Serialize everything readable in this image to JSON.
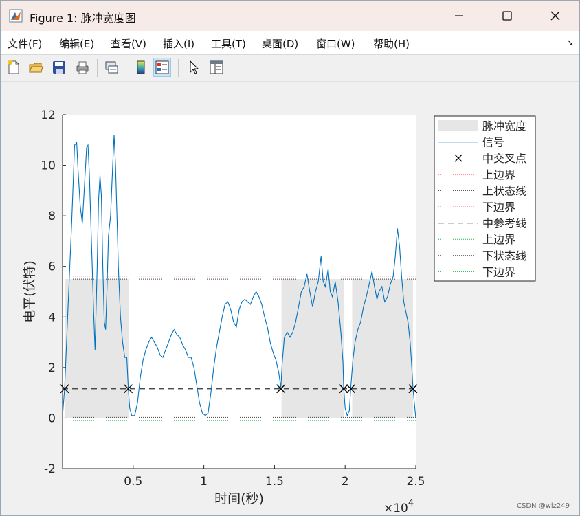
{
  "window": {
    "title": "Figure 1: 脉冲宽度图",
    "icon": "matlab-logo-icon",
    "controls": [
      "minimize-icon",
      "maximize-icon",
      "close-icon"
    ]
  },
  "menu": [
    "文件(F)",
    "编辑(E)",
    "查看(V)",
    "插入(I)",
    "工具(T)",
    "桌面(D)",
    "窗口(W)",
    "帮助(H)"
  ],
  "menu_extra_icon": "dock-arrow-icon",
  "toolbar": [
    "new-figure-icon",
    "open-file-icon",
    "save-icon",
    "print-icon",
    "link-plot-icon",
    "colorbar-icon",
    "legend-icon",
    "pointer-icon",
    "property-inspector-icon"
  ],
  "watermark": "CSDN @wlz249",
  "chart_data": {
    "type": "line",
    "xlabel": "时间(秒)",
    "ylabel": "电平(伏特)",
    "x_exponent": "×10",
    "x_exponent_power": "4",
    "xlim": [
      0,
      25000
    ],
    "ylim": [
      -2,
      12
    ],
    "xticks": [
      0.5,
      1,
      1.5,
      2,
      2.5
    ],
    "xtick_labels": [
      "0.5",
      "1",
      "1.5",
      "2",
      "2.5"
    ],
    "yticks": [
      -2,
      0,
      2,
      4,
      6,
      8,
      10,
      12
    ],
    "ytick_labels": [
      "-2",
      "0",
      "2",
      "4",
      "6",
      "8",
      "10",
      "12"
    ],
    "grid": false,
    "legend_position": "outside-right",
    "colors": {
      "signal": "#0072bd",
      "pulse_fill": "#e6e6e6",
      "boundary": "#ff6b6b",
      "state": "#444444",
      "lower_boundary": "#22b14c",
      "reference": "#333333"
    },
    "pulse_width_regions": [
      [
        200,
        4700
      ],
      [
        15500,
        19900
      ],
      [
        20500,
        24800
      ]
    ],
    "pulse_region_top": 5.5,
    "levels": {
      "upper_boundary": 5.62,
      "upper_state": 5.5,
      "lower_boundary_red": 5.38,
      "mid_reference": 1.16,
      "upper_boundary_green": 0.16,
      "lower_state": 0.03,
      "lower_boundary_green": -0.1
    },
    "mid_crossings": [
      150,
      4650,
      15450,
      19900,
      20400,
      24800
    ],
    "series": [
      {
        "name": "信号",
        "points": [
          [
            0,
            0.1
          ],
          [
            150,
            1.2
          ],
          [
            400,
            4.5
          ],
          [
            650,
            7.8
          ],
          [
            850,
            10.8
          ],
          [
            1000,
            10.9
          ],
          [
            1100,
            9.8
          ],
          [
            1250,
            8.4
          ],
          [
            1400,
            7.7
          ],
          [
            1550,
            9.2
          ],
          [
            1700,
            10.7
          ],
          [
            1800,
            10.8
          ],
          [
            1900,
            9.6
          ],
          [
            2000,
            7.8
          ],
          [
            2100,
            6.0
          ],
          [
            2200,
            4.2
          ],
          [
            2300,
            2.7
          ],
          [
            2450,
            6.0
          ],
          [
            2550,
            8.6
          ],
          [
            2650,
            9.6
          ],
          [
            2750,
            8.8
          ],
          [
            2850,
            6.0
          ],
          [
            2950,
            3.8
          ],
          [
            3050,
            3.5
          ],
          [
            3150,
            5.2
          ],
          [
            3250,
            7.2
          ],
          [
            3400,
            8.0
          ],
          [
            3550,
            10.0
          ],
          [
            3650,
            11.2
          ],
          [
            3750,
            10.0
          ],
          [
            3850,
            8.0
          ],
          [
            3950,
            6.0
          ],
          [
            4100,
            4.0
          ],
          [
            4250,
            3.0
          ],
          [
            4400,
            2.4
          ],
          [
            4550,
            2.4
          ],
          [
            4650,
            1.2
          ],
          [
            4750,
            0.4
          ],
          [
            4900,
            0.1
          ],
          [
            5100,
            0.1
          ],
          [
            5300,
            0.6
          ],
          [
            5500,
            1.6
          ],
          [
            5700,
            2.3
          ],
          [
            5900,
            2.7
          ],
          [
            6100,
            3.0
          ],
          [
            6300,
            3.2
          ],
          [
            6500,
            3.0
          ],
          [
            6700,
            2.8
          ],
          [
            6900,
            2.5
          ],
          [
            7100,
            2.4
          ],
          [
            7300,
            2.7
          ],
          [
            7500,
            3.0
          ],
          [
            7700,
            3.3
          ],
          [
            7900,
            3.5
          ],
          [
            8100,
            3.3
          ],
          [
            8300,
            3.2
          ],
          [
            8500,
            2.9
          ],
          [
            8700,
            2.7
          ],
          [
            8900,
            2.4
          ],
          [
            9100,
            2.4
          ],
          [
            9300,
            2.0
          ],
          [
            9500,
            1.3
          ],
          [
            9700,
            0.6
          ],
          [
            9900,
            0.2
          ],
          [
            10100,
            0.1
          ],
          [
            10300,
            0.2
          ],
          [
            10500,
            1.0
          ],
          [
            10700,
            2.0
          ],
          [
            10900,
            2.8
          ],
          [
            11100,
            3.4
          ],
          [
            11300,
            4.0
          ],
          [
            11500,
            4.5
          ],
          [
            11700,
            4.6
          ],
          [
            11900,
            4.3
          ],
          [
            12100,
            3.8
          ],
          [
            12300,
            3.6
          ],
          [
            12500,
            4.3
          ],
          [
            12700,
            4.6
          ],
          [
            12900,
            4.7
          ],
          [
            13100,
            4.6
          ],
          [
            13300,
            4.5
          ],
          [
            13500,
            4.8
          ],
          [
            13700,
            5.0
          ],
          [
            13900,
            4.8
          ],
          [
            14100,
            4.5
          ],
          [
            14300,
            4.0
          ],
          [
            14500,
            3.6
          ],
          [
            14700,
            3.0
          ],
          [
            14900,
            2.6
          ],
          [
            15100,
            2.3
          ],
          [
            15300,
            1.8
          ],
          [
            15450,
            1.2
          ],
          [
            15550,
            2.2
          ],
          [
            15700,
            3.2
          ],
          [
            15900,
            3.4
          ],
          [
            16100,
            3.2
          ],
          [
            16300,
            3.4
          ],
          [
            16500,
            3.8
          ],
          [
            16700,
            4.4
          ],
          [
            16900,
            5.0
          ],
          [
            17100,
            5.2
          ],
          [
            17300,
            5.7
          ],
          [
            17500,
            5.0
          ],
          [
            17700,
            4.4
          ],
          [
            17900,
            5.0
          ],
          [
            18100,
            5.4
          ],
          [
            18300,
            6.4
          ],
          [
            18450,
            5.4
          ],
          [
            18600,
            5.2
          ],
          [
            18800,
            5.9
          ],
          [
            18950,
            5.0
          ],
          [
            19100,
            4.8
          ],
          [
            19300,
            5.4
          ],
          [
            19500,
            4.6
          ],
          [
            19700,
            3.4
          ],
          [
            19850,
            2.2
          ],
          [
            19900,
            1.2
          ],
          [
            20000,
            0.4
          ],
          [
            20150,
            0.1
          ],
          [
            20300,
            0.3
          ],
          [
            20400,
            1.2
          ],
          [
            20550,
            2.3
          ],
          [
            20700,
            3.0
          ],
          [
            20900,
            3.5
          ],
          [
            21100,
            3.8
          ],
          [
            21300,
            4.4
          ],
          [
            21500,
            4.8
          ],
          [
            21700,
            5.3
          ],
          [
            21900,
            5.8
          ],
          [
            22050,
            5.3
          ],
          [
            22250,
            4.7
          ],
          [
            22400,
            5.0
          ],
          [
            22600,
            5.2
          ],
          [
            22800,
            4.6
          ],
          [
            23000,
            4.8
          ],
          [
            23200,
            5.3
          ],
          [
            23400,
            5.6
          ],
          [
            23550,
            6.4
          ],
          [
            23700,
            7.5
          ],
          [
            23850,
            6.8
          ],
          [
            24000,
            5.6
          ],
          [
            24150,
            4.6
          ],
          [
            24300,
            4.2
          ],
          [
            24450,
            3.8
          ],
          [
            24600,
            3.0
          ],
          [
            24700,
            2.2
          ],
          [
            24800,
            1.2
          ],
          [
            24900,
            0.6
          ],
          [
            25000,
            0.0
          ]
        ]
      }
    ],
    "legend": [
      {
        "label": "脉冲宽度",
        "style": "patch"
      },
      {
        "label": "信号",
        "style": "solid"
      },
      {
        "label": "中交叉点",
        "style": "x-marker"
      },
      {
        "label": "上边界",
        "style": "dotted-red"
      },
      {
        "label": "上状态线",
        "style": "dotted-dark"
      },
      {
        "label": "下边界",
        "style": "dotted-red"
      },
      {
        "label": "中参考线",
        "style": "dashed"
      },
      {
        "label": "上边界",
        "style": "dotted-green"
      },
      {
        "label": "下状态线",
        "style": "dotted-dark"
      },
      {
        "label": "下边界",
        "style": "dotted-green"
      }
    ]
  }
}
